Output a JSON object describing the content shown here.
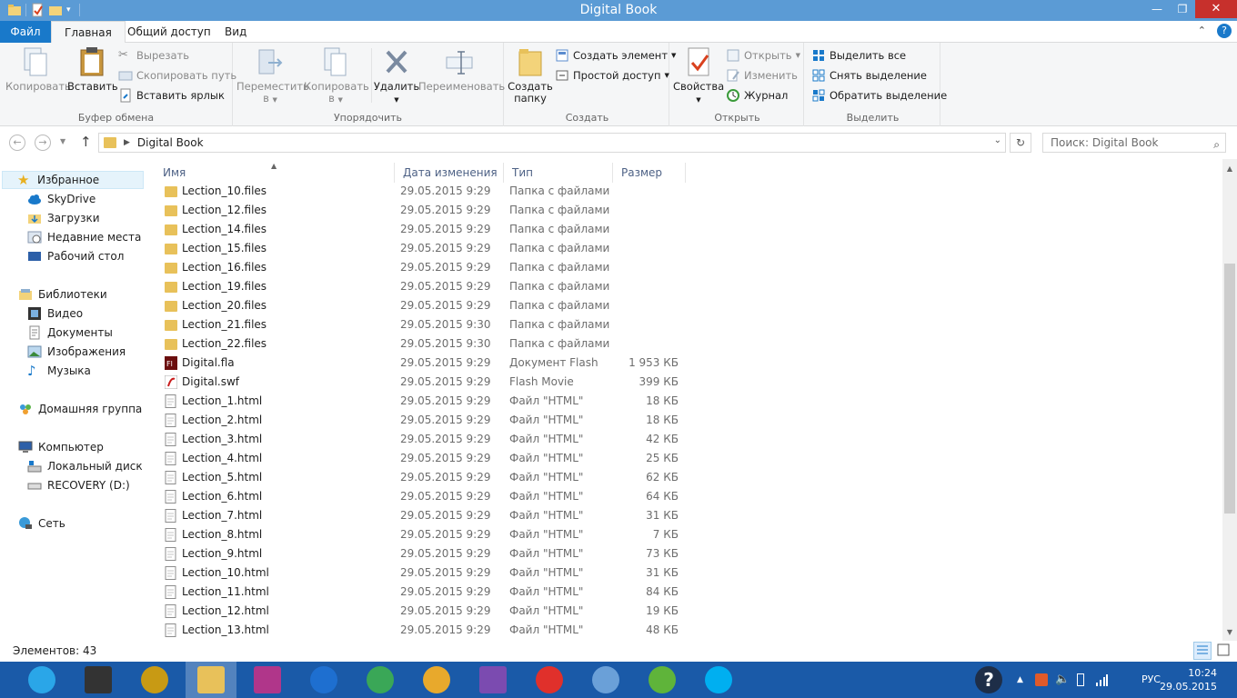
{
  "window": {
    "title": "Digital Book",
    "min_icon": "minimize-icon",
    "max_icon": "restore-icon",
    "close_icon": "close-icon"
  },
  "tabs": {
    "file": "Файл",
    "home": "Главная",
    "share": "Общий доступ",
    "view": "Вид"
  },
  "ribbon": {
    "clipboard": {
      "label": "Буфер обмена",
      "copy": "Копировать",
      "paste": "Вставить",
      "cut": "Вырезать",
      "copy_path": "Скопировать путь",
      "paste_shortcut": "Вставить ярлык"
    },
    "organize": {
      "label": "Упорядочить",
      "move_to": "Переместить",
      "copy_to": "Копировать",
      "to": "в",
      "delete": "Удалить",
      "rename": "Переименовать"
    },
    "new": {
      "label": "Создать",
      "new_folder_1": "Создать",
      "new_folder_2": "папку",
      "new_item": "Создать элемент",
      "easy_access": "Простой доступ"
    },
    "open": {
      "label": "Открыть",
      "properties": "Свойства",
      "open": "Открыть",
      "edit": "Изменить",
      "history": "Журнал"
    },
    "select": {
      "label": "Выделить",
      "select_all": "Выделить все",
      "select_none": "Снять выделение",
      "invert": "Обратить выделение"
    }
  },
  "address": {
    "path": "Digital Book",
    "search_placeholder": "Поиск: Digital Book"
  },
  "nav": {
    "favorites": "Избранное",
    "skydrive": "SkyDrive",
    "downloads": "Загрузки",
    "recent": "Недавние места",
    "desktop": "Рабочий стол",
    "libraries": "Библиотеки",
    "video": "Видео",
    "documents": "Документы",
    "pictures": "Изображения",
    "music": "Музыка",
    "homegroup": "Домашняя группа",
    "computer": "Компьютер",
    "local_disk": "Локальный диск (C:",
    "recovery": "RECOVERY (D:)",
    "network": "Сеть"
  },
  "columns": {
    "name": "Имя",
    "date": "Дата изменения",
    "type": "Тип",
    "size": "Размер"
  },
  "files": [
    {
      "name": "Lection_10.files",
      "date": "29.05.2015 9:29",
      "type": "Папка с файлами",
      "size": "",
      "kind": "folder"
    },
    {
      "name": "Lection_12.files",
      "date": "29.05.2015 9:29",
      "type": "Папка с файлами",
      "size": "",
      "kind": "folder"
    },
    {
      "name": "Lection_14.files",
      "date": "29.05.2015 9:29",
      "type": "Папка с файлами",
      "size": "",
      "kind": "folder"
    },
    {
      "name": "Lection_15.files",
      "date": "29.05.2015 9:29",
      "type": "Папка с файлами",
      "size": "",
      "kind": "folder"
    },
    {
      "name": "Lection_16.files",
      "date": "29.05.2015 9:29",
      "type": "Папка с файлами",
      "size": "",
      "kind": "folder"
    },
    {
      "name": "Lection_19.files",
      "date": "29.05.2015 9:29",
      "type": "Папка с файлами",
      "size": "",
      "kind": "folder"
    },
    {
      "name": "Lection_20.files",
      "date": "29.05.2015 9:29",
      "type": "Папка с файлами",
      "size": "",
      "kind": "folder"
    },
    {
      "name": "Lection_21.files",
      "date": "29.05.2015 9:30",
      "type": "Папка с файлами",
      "size": "",
      "kind": "folder"
    },
    {
      "name": "Lection_22.files",
      "date": "29.05.2015 9:30",
      "type": "Папка с файлами",
      "size": "",
      "kind": "folder"
    },
    {
      "name": "Digital.fla",
      "date": "29.05.2015 9:29",
      "type": "Документ Flash",
      "size": "1 953 КБ",
      "kind": "fla"
    },
    {
      "name": "Digital.swf",
      "date": "29.05.2015 9:29",
      "type": "Flash Movie",
      "size": "399 КБ",
      "kind": "swf"
    },
    {
      "name": "Lection_1.html",
      "date": "29.05.2015 9:29",
      "type": "Файл \"HTML\"",
      "size": "18 КБ",
      "kind": "html"
    },
    {
      "name": "Lection_2.html",
      "date": "29.05.2015 9:29",
      "type": "Файл \"HTML\"",
      "size": "18 КБ",
      "kind": "html"
    },
    {
      "name": "Lection_3.html",
      "date": "29.05.2015 9:29",
      "type": "Файл \"HTML\"",
      "size": "42 КБ",
      "kind": "html"
    },
    {
      "name": "Lection_4.html",
      "date": "29.05.2015 9:29",
      "type": "Файл \"HTML\"",
      "size": "25 КБ",
      "kind": "html"
    },
    {
      "name": "Lection_5.html",
      "date": "29.05.2015 9:29",
      "type": "Файл \"HTML\"",
      "size": "62 КБ",
      "kind": "html"
    },
    {
      "name": "Lection_6.html",
      "date": "29.05.2015 9:29",
      "type": "Файл \"HTML\"",
      "size": "64 КБ",
      "kind": "html"
    },
    {
      "name": "Lection_7.html",
      "date": "29.05.2015 9:29",
      "type": "Файл \"HTML\"",
      "size": "31 КБ",
      "kind": "html"
    },
    {
      "name": "Lection_8.html",
      "date": "29.05.2015 9:29",
      "type": "Файл \"HTML\"",
      "size": "7 КБ",
      "kind": "html"
    },
    {
      "name": "Lection_9.html",
      "date": "29.05.2015 9:29",
      "type": "Файл \"HTML\"",
      "size": "73 КБ",
      "kind": "html"
    },
    {
      "name": "Lection_10.html",
      "date": "29.05.2015 9:29",
      "type": "Файл \"HTML\"",
      "size": "31 КБ",
      "kind": "html"
    },
    {
      "name": "Lection_11.html",
      "date": "29.05.2015 9:29",
      "type": "Файл \"HTML\"",
      "size": "84 КБ",
      "kind": "html"
    },
    {
      "name": "Lection_12.html",
      "date": "29.05.2015 9:29",
      "type": "Файл \"HTML\"",
      "size": "19 КБ",
      "kind": "html"
    },
    {
      "name": "Lection_13.html",
      "date": "29.05.2015 9:29",
      "type": "Файл \"HTML\"",
      "size": "48 КБ",
      "kind": "html"
    }
  ],
  "status": {
    "count": "Элементов: 43"
  },
  "taskbar": {
    "apps": [
      {
        "icon": "internet-explorer-icon",
        "color": "#2aa6e8"
      },
      {
        "icon": "puzzle-app-icon",
        "color": "#333333"
      },
      {
        "icon": "media-player-icon",
        "color": "#c89a14"
      },
      {
        "icon": "file-explorer-icon",
        "color": "#e8c15a"
      },
      {
        "icon": "remote-app-icon",
        "color": "#b0368a"
      },
      {
        "icon": "hp-icon",
        "color": "#1e6fd0"
      },
      {
        "icon": "chrome-icon",
        "color": "#3aa757"
      },
      {
        "icon": "chrome-canary-icon",
        "color": "#e8a92c"
      },
      {
        "icon": "visual-studio-icon",
        "color": "#7b4bb0"
      },
      {
        "icon": "yandex-browser-icon",
        "color": "#e0302b"
      },
      {
        "icon": "audio-app-icon",
        "color": "#6aa0d8"
      },
      {
        "icon": "utorrent-icon",
        "color": "#5fb43a"
      },
      {
        "icon": "skype-icon",
        "color": "#00aff0"
      }
    ],
    "lang": "РУС",
    "time": "10:24",
    "date": "29.05.2015"
  },
  "colors": {
    "titlebar": "#5b9bd5",
    "file_tab": "#1979ca",
    "taskbar": "#1a5aa8",
    "close": "#c7302c"
  }
}
